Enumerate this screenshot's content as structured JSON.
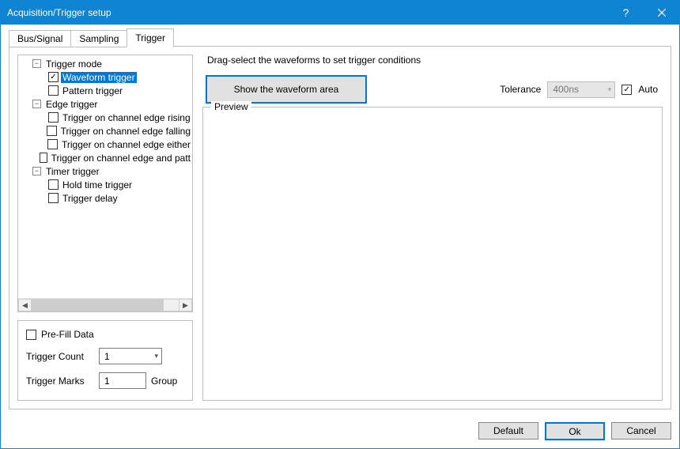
{
  "window": {
    "title": "Acquisition/Trigger setup"
  },
  "tabs": [
    "Bus/Signal",
    "Sampling",
    "Trigger"
  ],
  "active_tab": 2,
  "tree": {
    "groups": [
      {
        "label": "Trigger mode",
        "items": [
          {
            "label": "Waveform trigger",
            "checked": true,
            "selected": true
          },
          {
            "label": "Pattern trigger",
            "checked": false
          }
        ]
      },
      {
        "label": "Edge trigger",
        "items": [
          {
            "label": "Trigger on channel edge rising",
            "checked": false
          },
          {
            "label": "Trigger on channel edge falling",
            "checked": false
          },
          {
            "label": "Trigger on channel edge either",
            "checked": false
          },
          {
            "label": "Trigger on channel edge and patt",
            "checked": false
          }
        ]
      },
      {
        "label": "Timer trigger",
        "items": [
          {
            "label": "Hold time trigger",
            "checked": false
          },
          {
            "label": "Trigger delay",
            "checked": false
          }
        ]
      }
    ]
  },
  "options": {
    "prefill_label": "Pre-Fill Data",
    "prefill_checked": false,
    "trigger_count_label": "Trigger Count",
    "trigger_count_value": "1",
    "trigger_marks_label": "Trigger Marks",
    "trigger_marks_value": "1",
    "trigger_marks_unit": "Group"
  },
  "right": {
    "hint": "Drag-select the waveforms to set trigger conditions",
    "show_button": "Show the waveform area",
    "tolerance_label": "Tolerance",
    "tolerance_value": "400ns",
    "auto_label": "Auto",
    "auto_checked": true,
    "preview_label": "Preview"
  },
  "buttons": {
    "default": "Default",
    "ok": "Ok",
    "cancel": "Cancel"
  }
}
